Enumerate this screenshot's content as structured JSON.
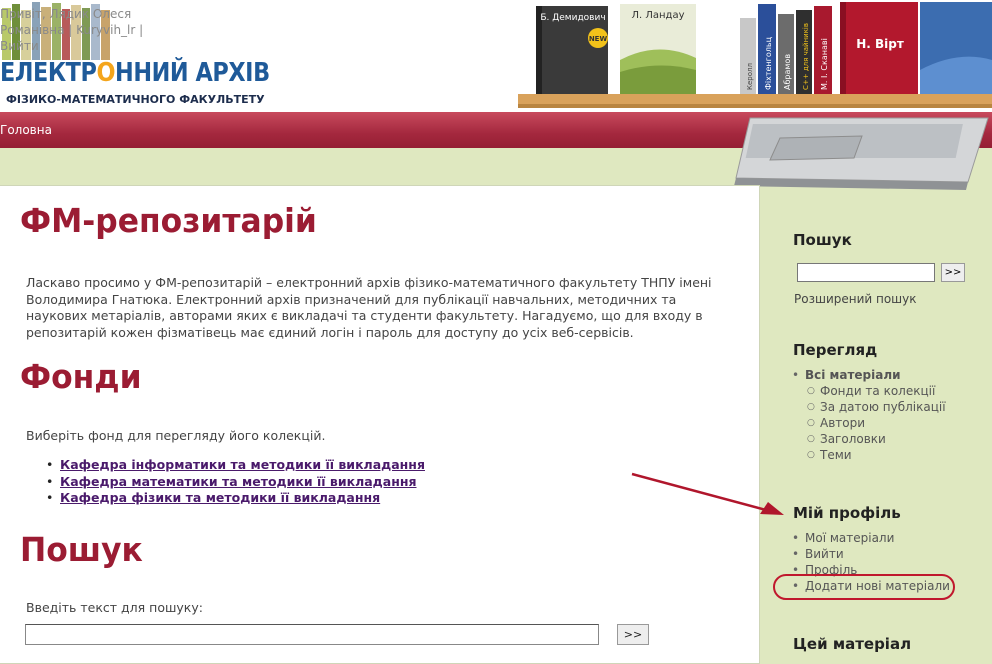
{
  "header": {
    "user_links": "Привіт, Лядик Олеся Романівна | Kuryvih_lr | Вийти",
    "logo_title_pre": "ЕЛЕКТР",
    "logo_title_dot": "О",
    "logo_title_post": "ННИЙ АРХІВ",
    "logo_subtitle": "ФІЗИКО-МАТЕМАТИЧНОГО ФАКУЛЬТЕТУ",
    "books": {
      "demidovich": "Б. Демидович",
      "new_badge": "NEW",
      "landau": "Л. Ландау",
      "kerroll": "Керолл",
      "fichtengolts": "Фіхтенгольц",
      "abramov": "Абрамов",
      "cpp": "C++ для чайників",
      "skanavi": "М. І. Сканаві",
      "virt": "Н. Вірт"
    }
  },
  "nav": {
    "home": "Головна"
  },
  "main": {
    "title": "ФМ-репозитарій",
    "intro": "Ласкаво просимо у ФМ-репозитарій – електронний архів фізико-математичного факультету ТНПУ імені Володимира Гнатюка. Електронний архів призначений для публікації навчальних, методичних та наукових метаріалів, авторами яких є викладачі та студенти факультету. Нагадуємо, що для входу в репозитарій кожен фізматівець має єдиний логін і пароль для доступу до усіх веб-сервісів.",
    "fonds_title": "Фонди",
    "fonds_prompt": "Виберіть фонд для перегляду його колекцій.",
    "fonds": [
      "Кафедра інформатики та методики її викладання",
      "Кафедра математики та методики її викладання",
      "Кафедра фізики та методики її викладання"
    ],
    "search_title": "Пошук",
    "search_prompt": "Введіть текст для пошуку:",
    "search_button": ">>"
  },
  "sidebar": {
    "search_title": "Пошук",
    "search_button": ">>",
    "advanced_search": "Розширений пошук",
    "browse_title": "Перегляд",
    "browse_all": "Всі матеріали",
    "browse_items": [
      "Фонди та колекції",
      "За датою публікації",
      "Автори",
      "Заголовки",
      "Теми"
    ],
    "profile_title": "Мій профіль",
    "profile_items": [
      "Мої матеріали",
      "Вийти",
      "Профіль",
      "Додати нові матеріали"
    ],
    "this_item_title": "Цей матеріал"
  },
  "colors": {
    "accent": "#9b1c33",
    "nav": "#a4283e",
    "sidebar_bg": "#dfe8c0",
    "annotation": "#c0182d"
  }
}
